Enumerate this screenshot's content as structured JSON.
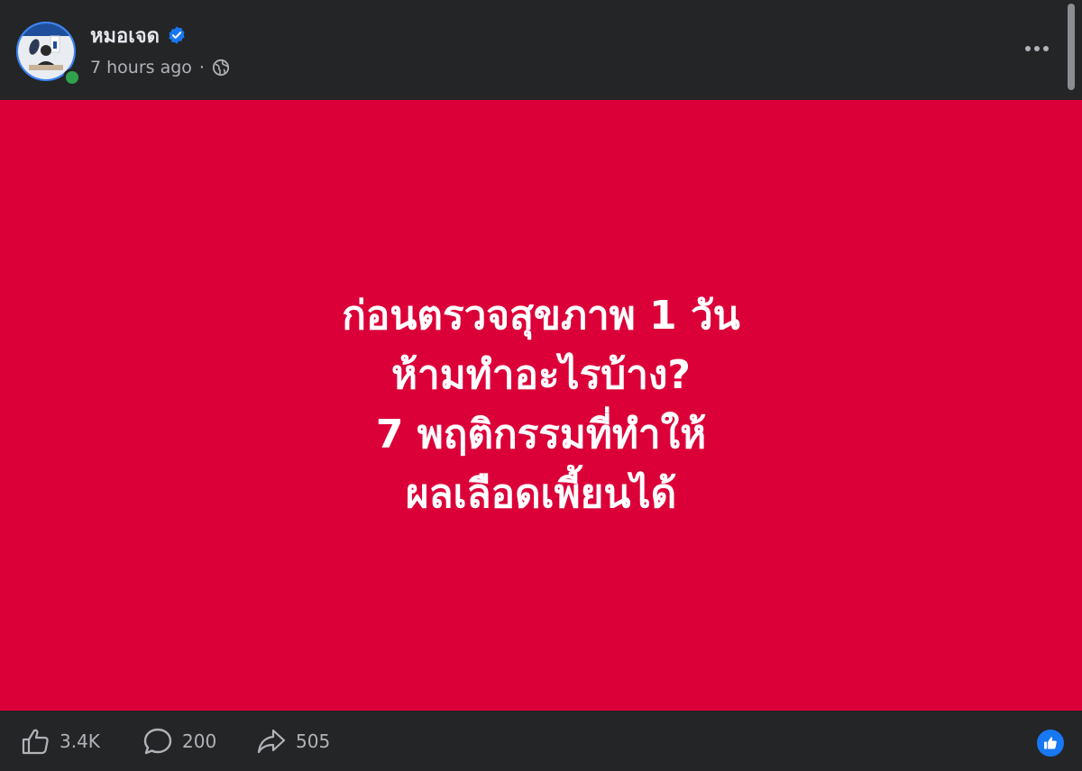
{
  "post": {
    "author": "หมอเจด",
    "verified": true,
    "time": "7 hours ago",
    "separator": "·",
    "audience_icon": "globe-icon"
  },
  "card": {
    "background": "#dc0039",
    "lines": [
      "ก่อนตรวจสุขภาพ 1 วัน",
      "ห้ามทำอะไรบ้าง?",
      "7 พฤติกรรมที่ทำให้",
      "ผลเลือดเพี้ยนได้"
    ]
  },
  "actions": {
    "likes": "3.4K",
    "comments": "200",
    "shares": "505"
  },
  "colors": {
    "accent": "#1877f2",
    "online": "#31a24c"
  }
}
